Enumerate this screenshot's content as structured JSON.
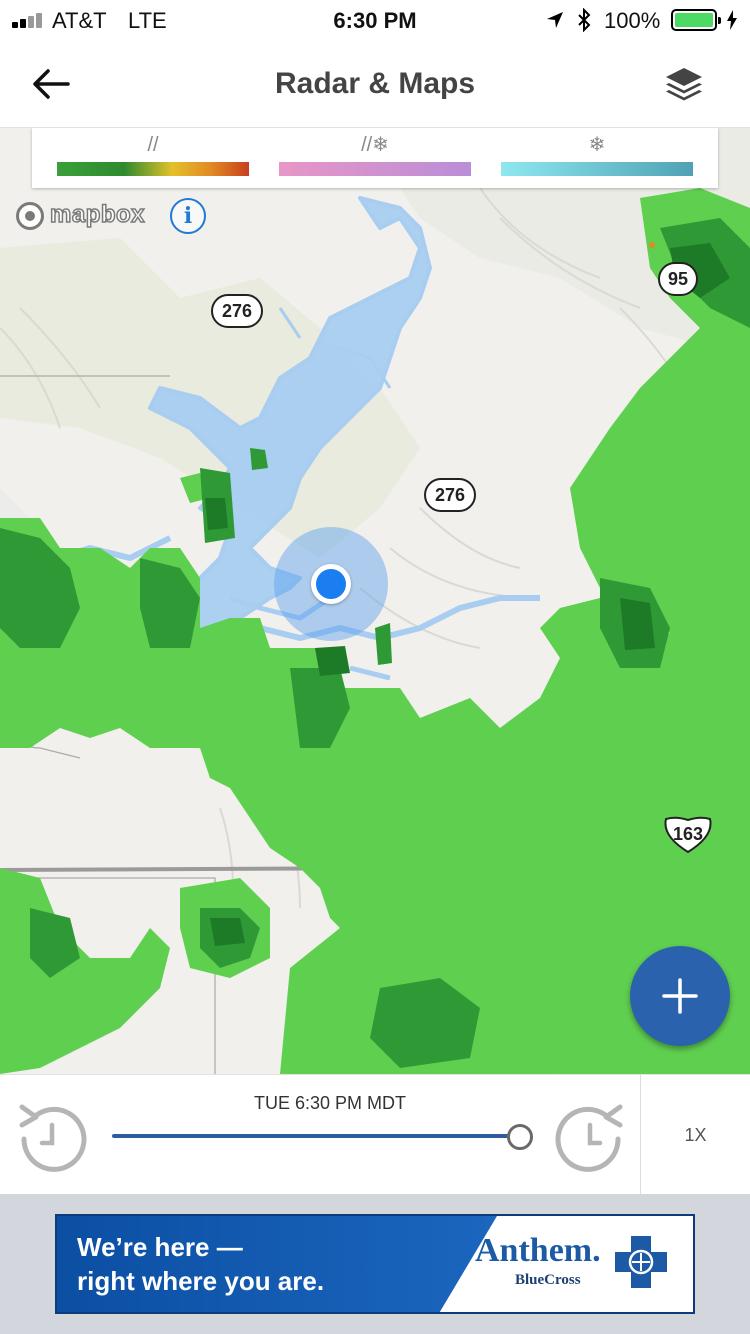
{
  "status_bar": {
    "carrier": "AT&T",
    "network": "LTE",
    "time": "6:30 PM",
    "battery_percent": "100%"
  },
  "header": {
    "title": "Radar & Maps"
  },
  "legend": {
    "items": [
      {
        "symbol": "rain-icon",
        "gradient": [
          "#3aa03a",
          "#e2c12a",
          "#c6401f"
        ]
      },
      {
        "symbol": "mix-icon",
        "gradient": [
          "#e896c6",
          "#b98ed8"
        ]
      },
      {
        "symbol": "snow-icon",
        "gradient": [
          "#8ee8f0",
          "#4fa2b4"
        ]
      }
    ]
  },
  "map": {
    "attribution": "mapbox",
    "info_symbol": "i",
    "route_shields": [
      {
        "label": "276",
        "type": "state"
      },
      {
        "label": "276",
        "type": "state"
      },
      {
        "label": "95",
        "type": "state"
      },
      {
        "label": "163",
        "type": "us"
      }
    ],
    "colors": {
      "water": "#a8cdf0",
      "radar_light": "#5fcf4f",
      "radar_dark": "#1f8a2a",
      "location": "#1a7ef0"
    }
  },
  "timeline": {
    "time_label": "TUE 6:30 PM MDT",
    "speed": "1X",
    "progress": 1.0
  },
  "ad": {
    "tagline_line1": "We’re here —",
    "tagline_line2": "right where you are.",
    "brand": "Anthem.",
    "brand_sub": "BlueCross"
  }
}
